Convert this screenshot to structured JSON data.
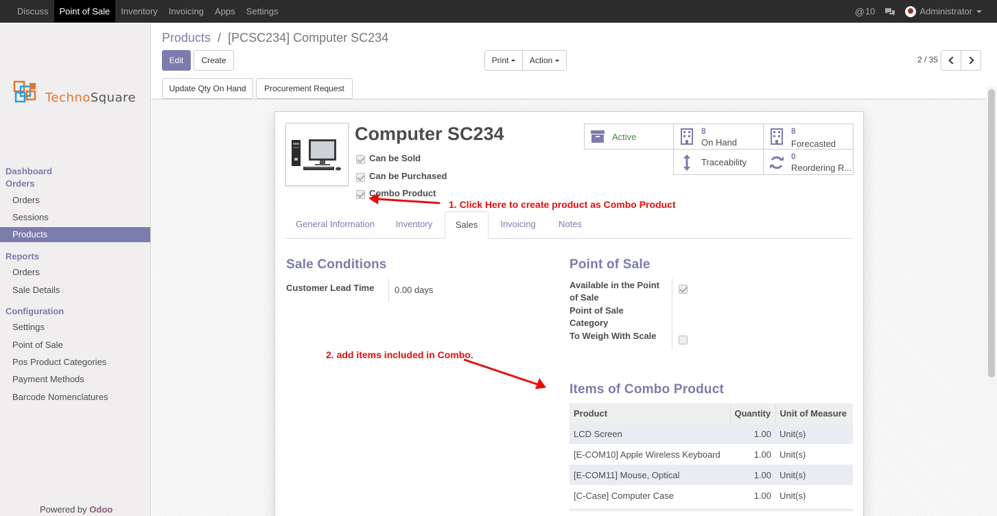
{
  "topnav": {
    "items": [
      "Discuss",
      "Point of Sale",
      "Inventory",
      "Invoicing",
      "Apps",
      "Settings"
    ],
    "active": "Point of Sale",
    "mail_count": "10",
    "user": "Administrator"
  },
  "sidebar": {
    "logo": {
      "prefix": "Techno",
      "suffix": "Square"
    },
    "sections": [
      {
        "title": "Dashboard"
      },
      {
        "title": "Orders",
        "items": [
          "Orders",
          "Sessions",
          "Products"
        ]
      },
      {
        "title": "Reports",
        "items": [
          "Orders",
          "Sale Details"
        ]
      },
      {
        "title": "Configuration",
        "items": [
          "Settings",
          "Point of Sale",
          "Pos Product Categories",
          "Payment Methods",
          "Barcode Nomenclatures"
        ]
      }
    ],
    "active_item": "Products",
    "powered_prefix": "Powered by",
    "powered_brand": "Odoo"
  },
  "breadcrumb": {
    "parent": "Products",
    "separator": "/",
    "current": "[PCSC234] Computer SC234"
  },
  "toolbar": {
    "edit": "Edit",
    "create": "Create",
    "print": "Print",
    "action": "Action",
    "pager": "2 / 35"
  },
  "statusbar": {
    "update_qty": "Update Qty On Hand",
    "procurement": "Procurement Request"
  },
  "product": {
    "name": "Computer SC234",
    "checkboxes": [
      {
        "label": "Can be Sold",
        "checked": true
      },
      {
        "label": "Can be Purchased",
        "checked": true
      },
      {
        "label": "Combo Product",
        "checked": true
      }
    ]
  },
  "smart_buttons": {
    "active": "Active",
    "on_hand": {
      "value": "8",
      "label": "On Hand"
    },
    "forecasted": {
      "value": "8",
      "label": "Forecasted"
    },
    "traceability": "Traceability",
    "reordering": {
      "value": "0",
      "label": "Reordering R..."
    }
  },
  "tabs": [
    "General Information",
    "Inventory",
    "Sales",
    "Invoicing",
    "Notes"
  ],
  "active_tab": "Sales",
  "sale_conditions": {
    "title": "Sale Conditions",
    "lead_time_label": "Customer Lead Time",
    "lead_time_value": "0.00 days"
  },
  "point_of_sale": {
    "title": "Point of Sale",
    "available_label_1": "Available in the Point",
    "available_label_2": "of Sale",
    "available_checked": true,
    "category_label_1": "Point of Sale",
    "category_label_2": "Category",
    "weigh_label": "To Weigh With Scale",
    "weigh_checked": false
  },
  "combo": {
    "title": "Items of Combo Product",
    "headers": [
      "Product",
      "Quantity",
      "Unit of Measure"
    ],
    "rows": [
      {
        "product": "LCD Screen",
        "qty": "1.00",
        "uom": "Unit(s)"
      },
      {
        "product": "[E-COM10] Apple Wireless Keyboard",
        "qty": "1.00",
        "uom": "Unit(s)"
      },
      {
        "product": "[E-COM11] Mouse, Optical",
        "qty": "1.00",
        "uom": "Unit(s)"
      },
      {
        "product": "[C-Case] Computer Case",
        "qty": "1.00",
        "uom": "Unit(s)"
      }
    ]
  },
  "annotations": {
    "step1": "1. Click Here to create product as Combo Product",
    "step2": "2. add items included in Combo.",
    "color": "#e80c0c"
  },
  "colors": {
    "accent": "#7c7bad",
    "topbar": "#2c2c2c",
    "sidebar": "#f0eeee",
    "active_status": "#3c8a3c"
  }
}
